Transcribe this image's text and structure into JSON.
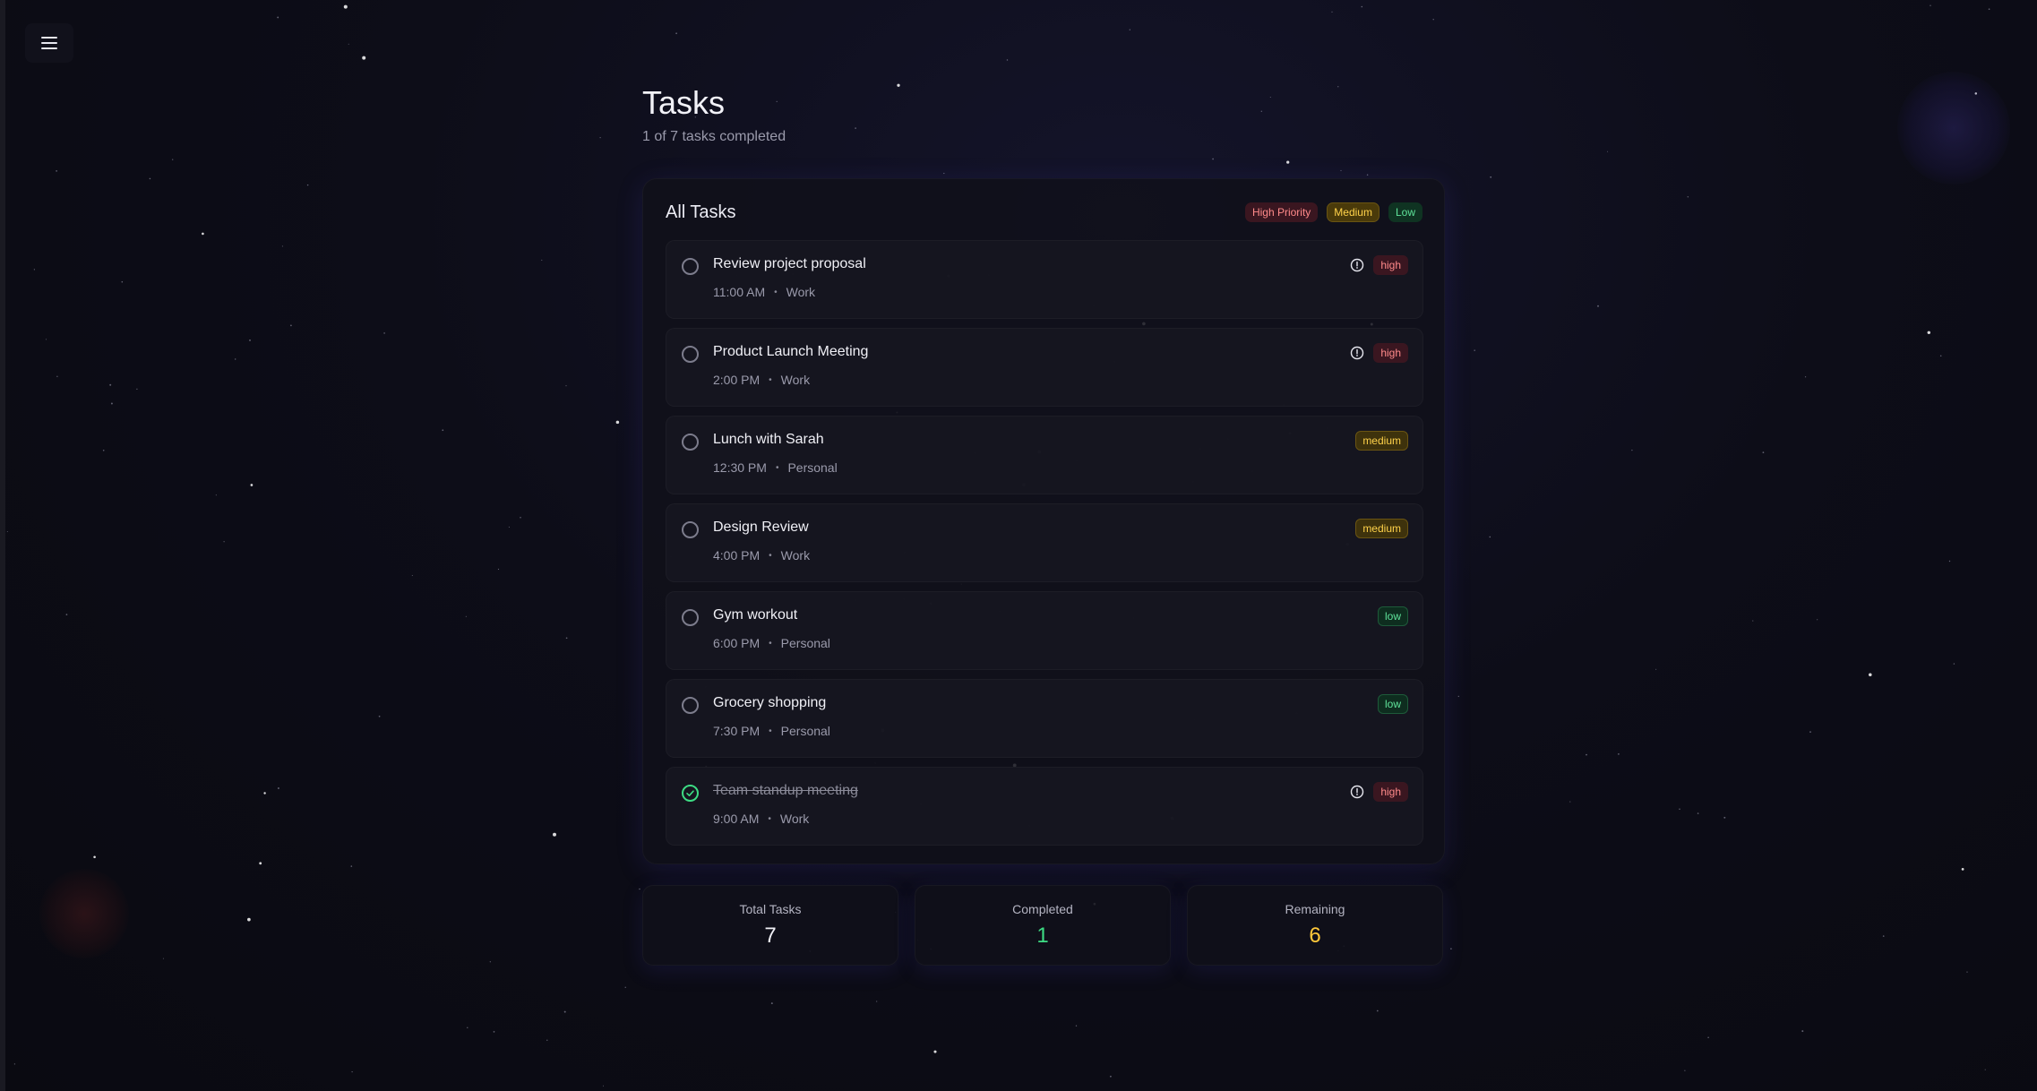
{
  "header": {
    "title": "Tasks",
    "subtitle": "1 of 7 tasks completed"
  },
  "card": {
    "title": "All Tasks",
    "legend": {
      "high": "High Priority",
      "medium": "Medium",
      "low": "Low"
    }
  },
  "tasks": [
    {
      "name": "Review project proposal",
      "time": "11:00 AM",
      "category": "Work",
      "priority": "high",
      "completed": false
    },
    {
      "name": "Product Launch Meeting",
      "time": "2:00 PM",
      "category": "Work",
      "priority": "high",
      "completed": false
    },
    {
      "name": "Lunch with Sarah",
      "time": "12:30 PM",
      "category": "Personal",
      "priority": "medium",
      "completed": false
    },
    {
      "name": "Design Review",
      "time": "4:00 PM",
      "category": "Work",
      "priority": "medium",
      "completed": false
    },
    {
      "name": "Gym workout",
      "time": "6:00 PM",
      "category": "Personal",
      "priority": "low",
      "completed": false
    },
    {
      "name": "Grocery shopping",
      "time": "7:30 PM",
      "category": "Personal",
      "priority": "low",
      "completed": false
    },
    {
      "name": "Team standup meeting",
      "time": "9:00 AM",
      "category": "Work",
      "priority": "high",
      "completed": true
    }
  ],
  "stats": {
    "total_label": "Total Tasks",
    "total_value": "7",
    "completed_label": "Completed",
    "completed_value": "1",
    "remaining_label": "Remaining",
    "remaining_value": "6"
  },
  "icons": {
    "menu": "menu-icon",
    "alert": "alert-circle-icon",
    "check": "check-circle-icon"
  },
  "colors": {
    "high": "#ff8a8a",
    "medium": "#ffd24a",
    "low": "#5fe39a",
    "completed": "#3ddc84",
    "remaining": "#ffc83a"
  }
}
